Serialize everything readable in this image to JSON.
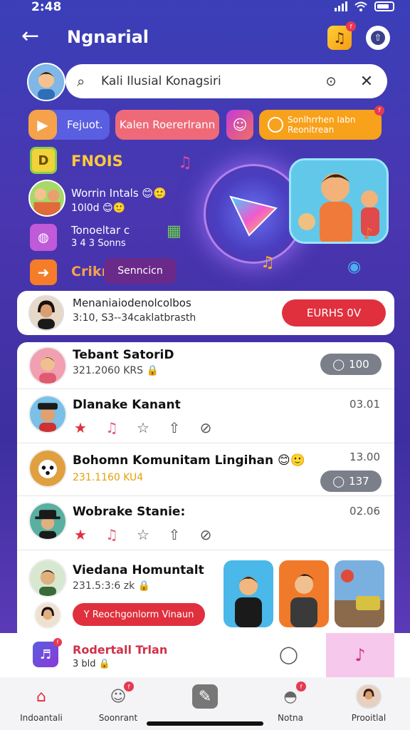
{
  "status": {
    "time": "2:48"
  },
  "header": {
    "title": "Ngnarial",
    "music_badge": "f"
  },
  "search": {
    "value": "Kali Ilusial Konagsiri"
  },
  "chips": [
    {
      "label": "Fejuot."
    },
    {
      "label": "Kalen Roererlrann"
    },
    {
      "label": ""
    },
    {
      "label": "Sonlhrrhen Iabn Reonitrean",
      "badge": "f"
    }
  ],
  "hero": {
    "section_title": "FNOIS",
    "item1": {
      "title": "Worrin Intals 😊🙂",
      "sub": "10l0d 😊🙂"
    },
    "item2": {
      "title": "Tonoeltar c",
      "sub": "3 4 3 Sonns"
    },
    "item3": {
      "title": "Crikn",
      "pill": "Senncicn"
    }
  },
  "featured": {
    "title": "Menaniaiodenolcolbos",
    "sub": "3:10, S3--34caklatbrasth",
    "button": "EURHS 0V"
  },
  "list": [
    {
      "name": "Tebant SatoriD",
      "meta": "321.2060 KRS 🔒",
      "badge": "100"
    },
    {
      "name": "Dlanake Kanant",
      "time": "03.01"
    },
    {
      "name": "Bohomn Komunitam Lingihan 😊🙂",
      "meta": "231.1160 KU4",
      "time": "13.00",
      "badge": "137"
    },
    {
      "name": "Wobrake Stanie:",
      "time": "02.06"
    },
    {
      "name": "Viedana Homuntalt",
      "meta": "231.5:3:6 zk 🔒",
      "cta": "Y Reochgonlorm Vinaun"
    }
  ],
  "player": {
    "title": "Rodertall Trlan",
    "sub": "3 bld 🔒"
  },
  "nav": [
    {
      "label": "Indoantali"
    },
    {
      "label": "Soonrant",
      "badge": "f"
    },
    {
      "label": ""
    },
    {
      "label": "Notna",
      "badge": "f"
    },
    {
      "label": "Prooitlal"
    }
  ],
  "colors": {
    "accent_red": "#e0303e",
    "bg_blue": "#3a3fb8",
    "gold": "#ffc93c"
  },
  "icons": [
    "back-arrow-icon",
    "music-icon",
    "upload-icon",
    "search-icon",
    "scan-icon",
    "close-icon",
    "play-icon",
    "star-icon",
    "note-icon",
    "heart-icon",
    "share-icon",
    "chat-icon"
  ]
}
